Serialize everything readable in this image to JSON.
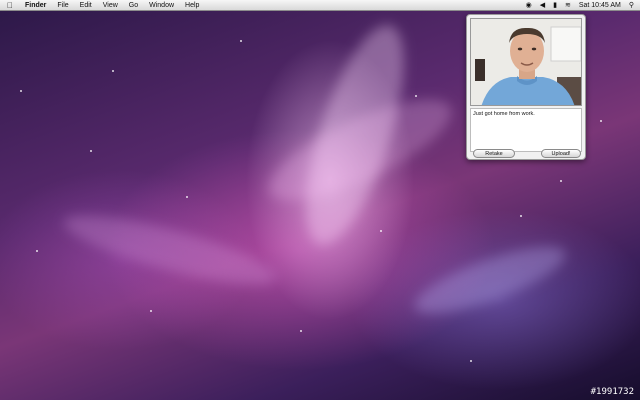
{
  "menubar": {
    "apple_label": "",
    "app_name": "Finder",
    "menus": [
      "File",
      "Edit",
      "View",
      "Go",
      "Window",
      "Help"
    ],
    "status": {
      "clock": "Sat 10:45 AM"
    }
  },
  "popup": {
    "caption_value": "Just got home from work.",
    "retake_label": "Retake",
    "upload_label": "Upload!"
  },
  "watermark": "#1991732",
  "colors": {
    "wallpaper_primary": "#7a3677",
    "wallpaper_dark": "#160d2c",
    "menubar_bg": "#e6e6e6"
  }
}
